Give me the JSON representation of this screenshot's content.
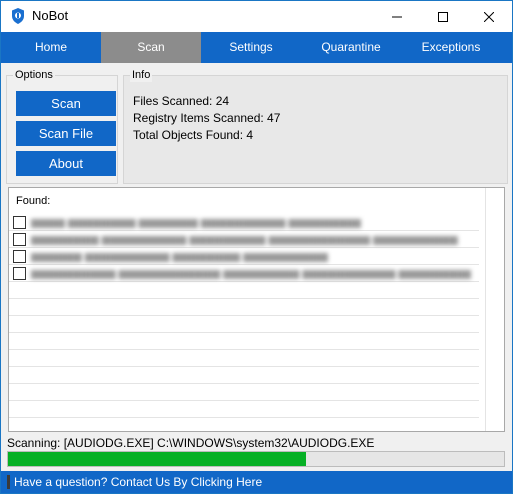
{
  "window": {
    "title": "NoBot"
  },
  "nav": {
    "items": [
      {
        "label": "Home",
        "active": false
      },
      {
        "label": "Scan",
        "active": true
      },
      {
        "label": "Settings",
        "active": false
      },
      {
        "label": "Quarantine",
        "active": false
      },
      {
        "label": "Exceptions",
        "active": false
      }
    ]
  },
  "options": {
    "legend": "Options",
    "buttons": [
      {
        "label": "Scan"
      },
      {
        "label": "Scan File"
      },
      {
        "label": "About"
      }
    ]
  },
  "info": {
    "legend": "Info",
    "files_scanned": "Files Scanned: 24",
    "registry_scanned": "Registry Items Scanned: 47",
    "total_found": "Total Objects Found: 4"
  },
  "found": {
    "label": "Found:",
    "items": [
      {
        "checked": false
      },
      {
        "checked": false
      },
      {
        "checked": false
      },
      {
        "checked": false
      }
    ]
  },
  "status": {
    "scanning_text": "Scanning: [AUDIODG.EXE] C:\\WINDOWS\\system32\\AUDIODG.EXE",
    "progress": 0.6
  },
  "footer": {
    "link_text": "Have a question? Contact Us By Clicking Here"
  },
  "colors": {
    "accent": "#1167c7",
    "active_tab": "#8c8c8c",
    "progress": "#06b025"
  }
}
